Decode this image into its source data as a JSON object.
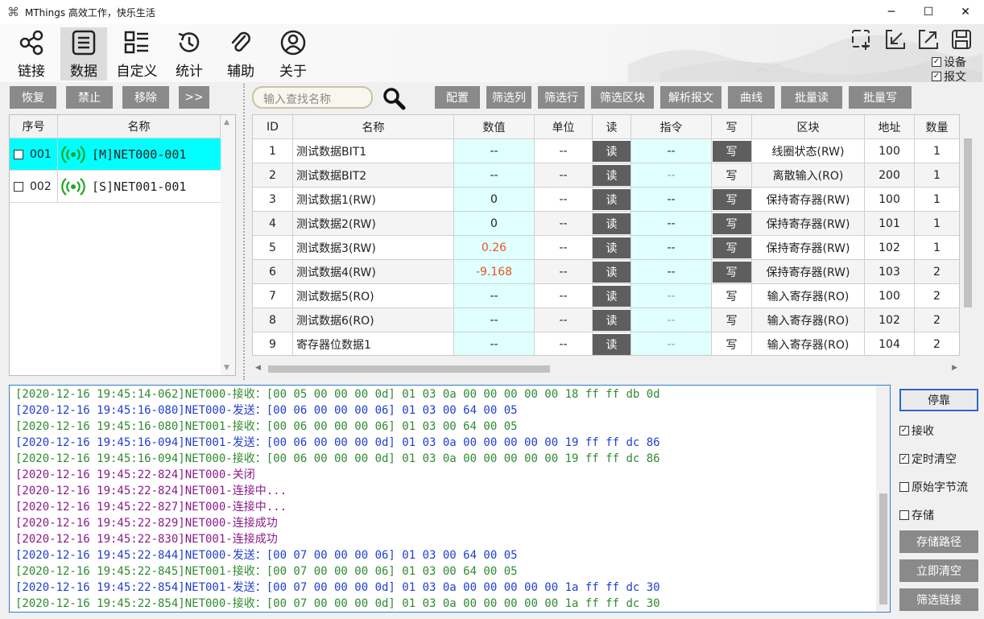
{
  "window": {
    "title": "MThings  高效工作，快乐生活",
    "minimize": "─",
    "maximize": "☐",
    "close": "✕"
  },
  "toolbar": {
    "items": [
      {
        "label": "链接",
        "icon": "share-icon"
      },
      {
        "label": "数据",
        "icon": "document-list-icon",
        "active": true
      },
      {
        "label": "自定义",
        "icon": "grid-list-icon"
      },
      {
        "label": "统计",
        "icon": "history-clock-icon"
      },
      {
        "label": "辅助",
        "icon": "paperclip-icon"
      },
      {
        "label": "关于",
        "icon": "user-circle-icon"
      }
    ],
    "right_icons": [
      "add-window-icon",
      "dock-in-icon",
      "pop-out-icon",
      "save-icon"
    ],
    "checkboxes": [
      {
        "label": "设备",
        "checked": true
      },
      {
        "label": "报文",
        "checked": true
      }
    ]
  },
  "left": {
    "buttons": [
      "恢复",
      "禁止",
      "移除",
      ">>"
    ],
    "headers": [
      "序号",
      "名称"
    ],
    "rows": [
      {
        "seq": "001",
        "name": "[M]NET000-001",
        "selected": true
      },
      {
        "seq": "002",
        "name": "[S]NET001-001",
        "selected": false
      }
    ]
  },
  "search": {
    "placeholder": "输入查找名称"
  },
  "actions": [
    "配置",
    "筛选列",
    "筛选行",
    "筛选区块",
    "解析报文",
    "曲线",
    "批量读",
    "批量写"
  ],
  "grid": {
    "headers": [
      "ID",
      "名称",
      "数值",
      "单位",
      "读",
      "指令",
      "写",
      "区块",
      "地址",
      "数量"
    ],
    "rows": [
      {
        "id": "1",
        "name": "测试数据BIT1",
        "value": "--",
        "unit": "--",
        "read": "读",
        "cmd": "--",
        "write": "写",
        "write_btn": true,
        "block": "线圈状态(RW)",
        "addr": "100",
        "qty": "1"
      },
      {
        "id": "2",
        "name": "测试数据BIT2",
        "value": "--",
        "unit": "--",
        "read": "读",
        "cmd": "--",
        "write": "写",
        "write_btn": false,
        "block": "离散输入(RO)",
        "addr": "200",
        "qty": "1"
      },
      {
        "id": "3",
        "name": "测试数据1(RW)",
        "value": "0",
        "unit": "--",
        "read": "读",
        "cmd": "--",
        "write": "写",
        "write_btn": true,
        "block": "保持寄存器(RW)",
        "addr": "100",
        "qty": "1"
      },
      {
        "id": "4",
        "name": "测试数据2(RW)",
        "value": "0",
        "unit": "--",
        "read": "读",
        "cmd": "--",
        "write": "写",
        "write_btn": true,
        "block": "保持寄存器(RW)",
        "addr": "101",
        "qty": "1"
      },
      {
        "id": "5",
        "name": "测试数据3(RW)",
        "value": "0.26",
        "value_hl": true,
        "unit": "--",
        "read": "读",
        "cmd": "--",
        "write": "写",
        "write_btn": true,
        "block": "保持寄存器(RW)",
        "addr": "102",
        "qty": "1"
      },
      {
        "id": "6",
        "name": "测试数据4(RW)",
        "value": "-9.168",
        "value_hl": true,
        "unit": "--",
        "read": "读",
        "cmd": "--",
        "write": "写",
        "write_btn": true,
        "block": "保持寄存器(RW)",
        "addr": "103",
        "qty": "2"
      },
      {
        "id": "7",
        "name": "测试数据5(RO)",
        "value": "--",
        "unit": "--",
        "read": "读",
        "cmd": "--",
        "write": "写",
        "write_btn": false,
        "block": "输入寄存器(RO)",
        "addr": "100",
        "qty": "2"
      },
      {
        "id": "8",
        "name": "测试数据6(RO)",
        "value": "--",
        "unit": "--",
        "read": "读",
        "cmd": "--",
        "write": "写",
        "write_btn": false,
        "block": "输入寄存器(RO)",
        "addr": "102",
        "qty": "2"
      },
      {
        "id": "9",
        "name": "寄存器位数据1",
        "value": "--",
        "unit": "--",
        "read": "读",
        "cmd": "--",
        "write": "写",
        "write_btn": false,
        "block": "输入寄存器(RO)",
        "addr": "104",
        "qty": "2"
      }
    ]
  },
  "log": {
    "lines": [
      {
        "text": "[2020-12-16 19:45:14-062]NET000-接收：[00 05 00 00 00 0d] 01 03 0a 00 00 00 00 00 18 ff ff db 0d",
        "kind": "recv"
      },
      {
        "text": "[2020-12-16 19:45:16-080]NET000-发送：[00 06 00 00 00 06] 01 03 00 64 00 05",
        "kind": "send"
      },
      {
        "text": "[2020-12-16 19:45:16-080]NET001-接收：[00 06 00 00 00 06] 01 03 00 64 00 05",
        "kind": "recv"
      },
      {
        "text": "[2020-12-16 19:45:16-094]NET001-发送：[00 06 00 00 00 0d] 01 03 0a 00 00 00 00 00 19 ff ff dc 86",
        "kind": "send"
      },
      {
        "text": "[2020-12-16 19:45:16-094]NET000-接收：[00 06 00 00 00 0d] 01 03 0a 00 00 00 00 00 19 ff ff dc 86",
        "kind": "recv"
      },
      {
        "text": "[2020-12-16 19:45:22-824]NET000-关闭",
        "kind": "status"
      },
      {
        "text": "[2020-12-16 19:45:22-824]NET001-连接中...",
        "kind": "status"
      },
      {
        "text": "[2020-12-16 19:45:22-827]NET000-连接中...",
        "kind": "status"
      },
      {
        "text": "[2020-12-16 19:45:22-829]NET000-连接成功",
        "kind": "status"
      },
      {
        "text": "[2020-12-16 19:45:22-830]NET001-连接成功",
        "kind": "status"
      },
      {
        "text": "[2020-12-16 19:45:22-844]NET000-发送：[00 07 00 00 00 06] 01 03 00 64 00 05",
        "kind": "send"
      },
      {
        "text": "[2020-12-16 19:45:22-845]NET001-接收：[00 07 00 00 00 06] 01 03 00 64 00 05",
        "kind": "recv"
      },
      {
        "text": "[2020-12-16 19:45:22-854]NET001-发送：[00 07 00 00 00 0d] 01 03 0a 00 00 00 00 00 1a ff ff dc 30",
        "kind": "send"
      },
      {
        "text": "[2020-12-16 19:45:22-854]NET000-接收：[00 07 00 00 00 0d] 01 03 0a 00 00 00 00 00 1a ff ff dc 30",
        "kind": "recv"
      }
    ]
  },
  "side": {
    "pause": "停靠",
    "checks": [
      {
        "label": "接收",
        "checked": true
      },
      {
        "label": "定时清空",
        "checked": true
      },
      {
        "label": "原始字节流",
        "checked": false
      },
      {
        "label": "存储",
        "checked": false
      }
    ],
    "buttons": [
      "存储路径",
      "立即清空",
      "筛选链接"
    ]
  },
  "colors": {
    "recv": "#2e8b2e",
    "send": "#1f3fd1",
    "status": "#8b1a8b",
    "selected_row": "#00ffff",
    "value_highlight": "#e9541f"
  }
}
